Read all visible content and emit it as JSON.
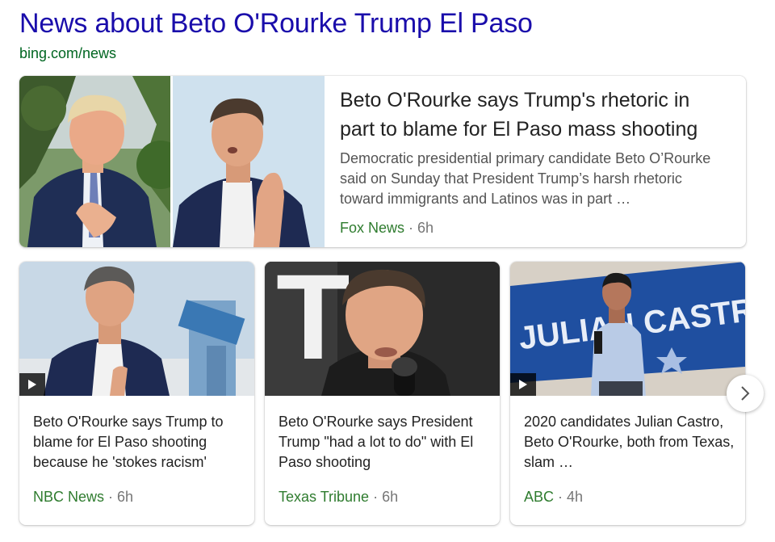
{
  "header": {
    "title": "News about Beto O'Rourke Trump El Paso",
    "source_url": "bing.com/news"
  },
  "featured": {
    "title": "Beto O'Rourke says Trump's rhetoric in part to blame for El Paso mass shooting",
    "snippet": "Democratic presidential primary candidate Beto O’Rourke said on Sunday that President Trump’s harsh rhetoric toward immigrants and Latinos was in part …",
    "source": "Fox News",
    "separator": "·",
    "age": "6h"
  },
  "cards": [
    {
      "title": "Beto O'Rourke says Trump to blame for El Paso shooting because he 'stokes racism'",
      "source": "NBC News",
      "separator": "·",
      "age": "6h",
      "video": true
    },
    {
      "title": "Beto O'Rourke says President Trump \"had a lot to do\" with El Paso shooting",
      "source": "Texas Tribune",
      "separator": "·",
      "age": "6h",
      "video": false
    },
    {
      "title": "2020 candidates Julian Castro, Beto O'Rourke, both from Texas, slam …",
      "source": "ABC",
      "separator": "·",
      "age": "4h",
      "video": true
    }
  ],
  "banner_text": "JULIAN CASTRO",
  "sign_text": "T",
  "icons": {
    "play": "play-icon",
    "next": "chevron-right-icon"
  },
  "colors": {
    "title_link": "#1a0dab",
    "url_green": "#006621",
    "source_green": "#2f7c2f",
    "meta_gray": "#767676"
  }
}
